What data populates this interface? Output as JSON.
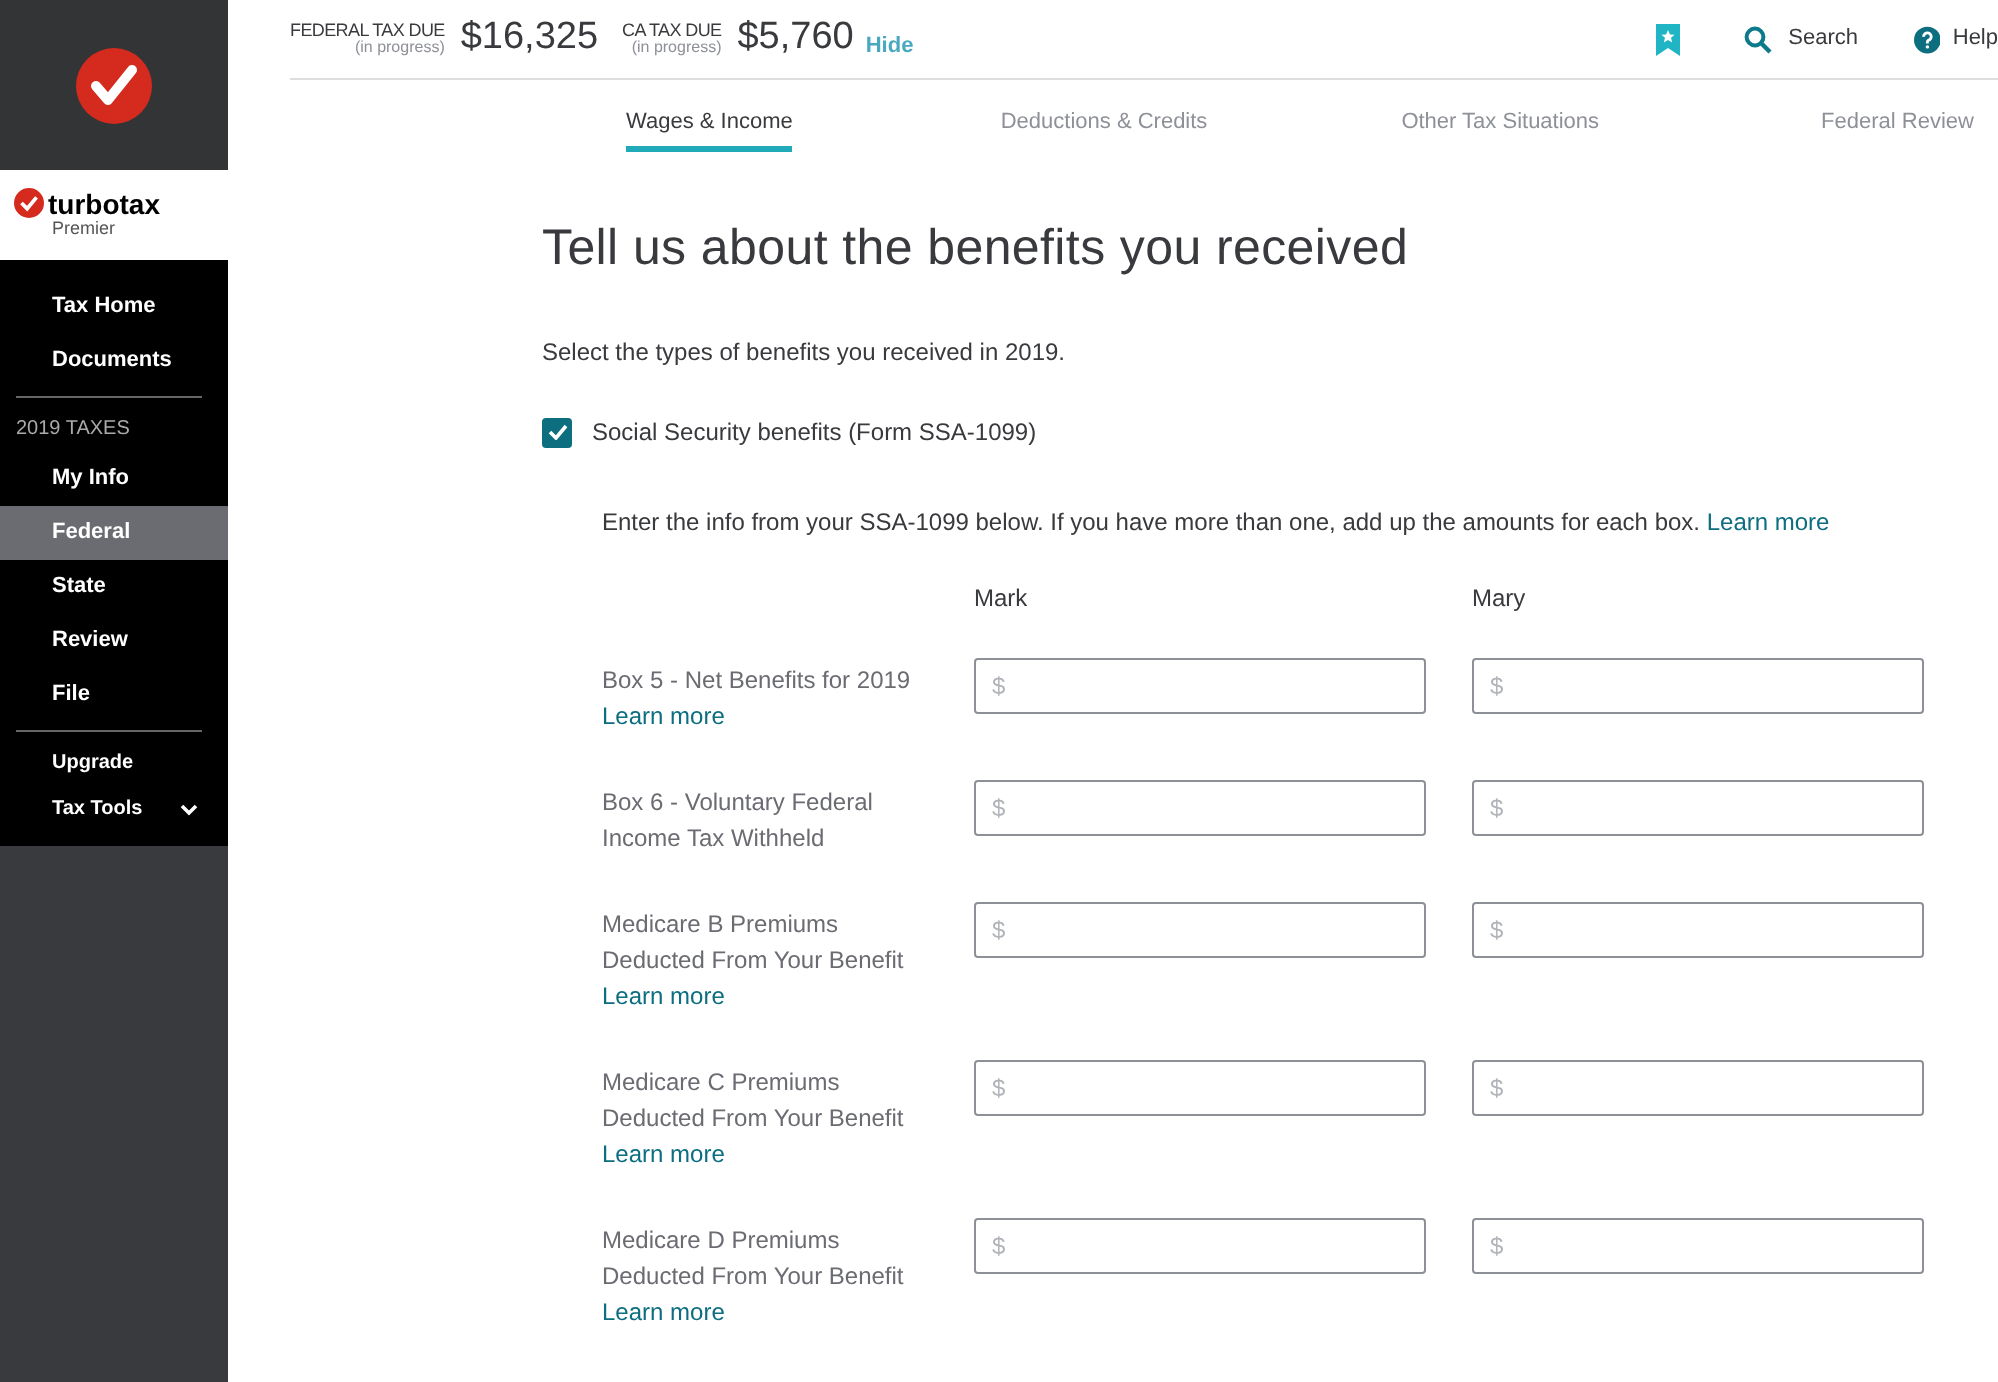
{
  "sidebar": {
    "brand": "turbotax",
    "edition": "Premier",
    "top_items": [
      {
        "label": "Tax Home",
        "selected": false
      },
      {
        "label": "Documents",
        "selected": false
      }
    ],
    "section_label": "2019 TAXES",
    "items": [
      {
        "label": "My Info",
        "selected": false
      },
      {
        "label": "Federal",
        "selected": true
      },
      {
        "label": "State",
        "selected": false
      },
      {
        "label": "Review",
        "selected": false
      },
      {
        "label": "File",
        "selected": false
      }
    ],
    "bottom_items": [
      {
        "label": "Upgrade",
        "expandable": false
      },
      {
        "label": "Tax Tools",
        "expandable": true
      }
    ]
  },
  "header": {
    "federal": {
      "label": "FEDERAL TAX DUE",
      "sub": "(in progress)",
      "amount": "$16,325"
    },
    "state": {
      "label": "CA TAX DUE",
      "sub": "(in progress)",
      "amount": "$5,760"
    },
    "hide": "Hide",
    "search": "Search",
    "help": "Help"
  },
  "tabs": [
    {
      "label": "Wages & Income",
      "selected": true
    },
    {
      "label": "Deductions & Credits",
      "selected": false
    },
    {
      "label": "Other Tax Situations",
      "selected": false
    },
    {
      "label": "Federal Review",
      "selected": false
    }
  ],
  "title": "Tell us about the benefits you received",
  "intro": "Select the types of benefits you received in 2019.",
  "benefit": {
    "label": "Social Security benefits (Form SSA-1099)",
    "checked": true
  },
  "instructions": "Enter the info from your SSA-1099 below. If you have more than one, add up the amounts for each box.",
  "instructions_link": "Learn more",
  "people": [
    "Mark",
    "Mary"
  ],
  "rows": [
    {
      "label": "Box 5 - Net Benefits for 2019",
      "link": "Learn more",
      "fields": [
        {
          "placeholder": "$"
        },
        {
          "placeholder": "$"
        }
      ]
    },
    {
      "label": "Box 6 - Voluntary Federal Income Tax Withheld",
      "fields": [
        {
          "placeholder": "$"
        },
        {
          "placeholder": "$"
        }
      ]
    },
    {
      "label": "Medicare B Premiums Deducted From Your Benefit",
      "link": "Learn more",
      "fields": [
        {
          "placeholder": "$"
        },
        {
          "placeholder": "$"
        }
      ]
    },
    {
      "label": "Medicare C Premiums Deducted From Your Benefit",
      "link": "Learn more",
      "fields": [
        {
          "placeholder": "$"
        },
        {
          "placeholder": "$"
        }
      ]
    },
    {
      "label": "Medicare D Premiums Deducted From Your Benefit",
      "link": "Learn more",
      "fields": [
        {
          "placeholder": "$"
        },
        {
          "placeholder": "$"
        }
      ]
    }
  ]
}
